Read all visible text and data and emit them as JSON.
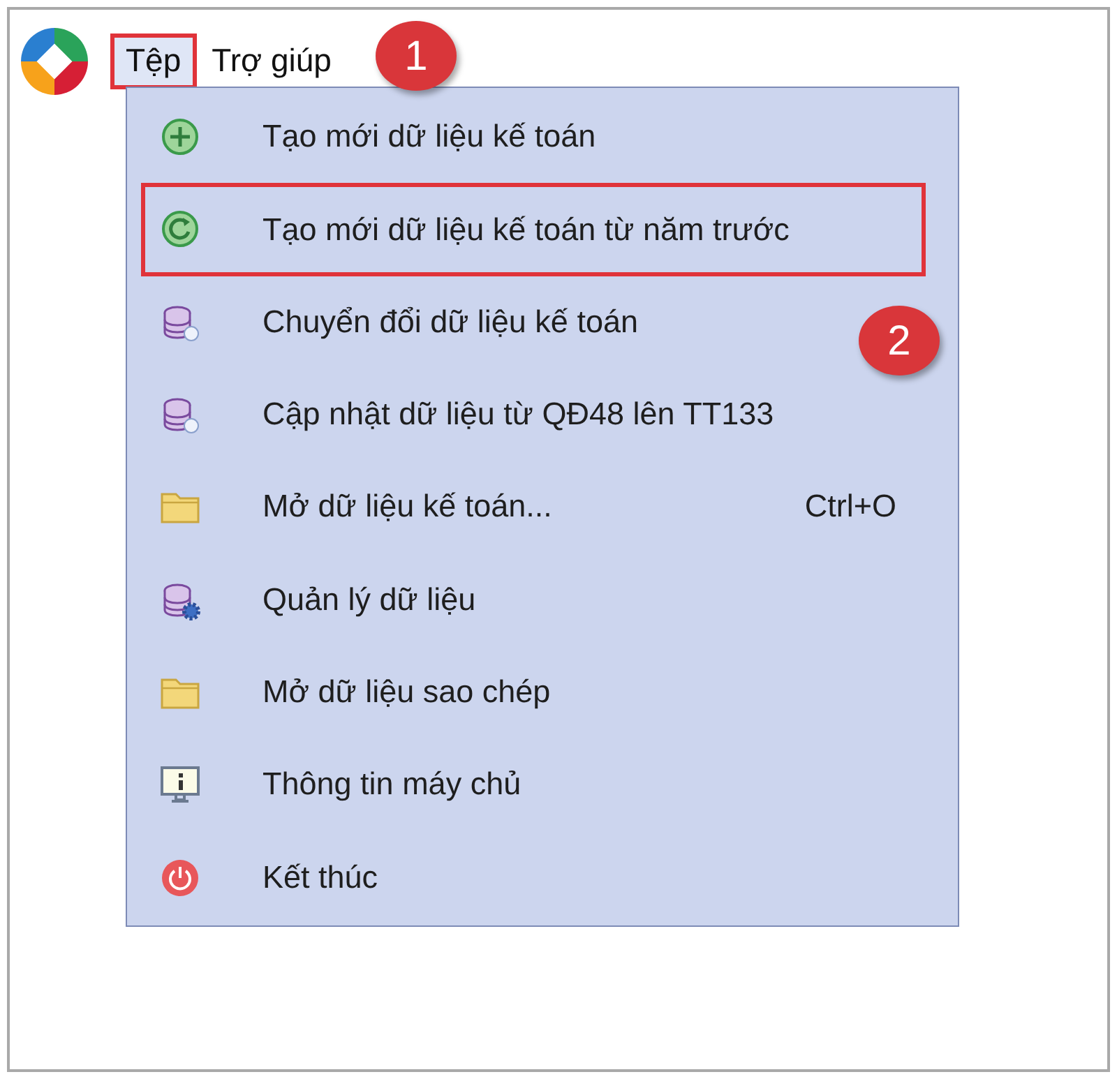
{
  "menubar": [
    {
      "label": "Tệp",
      "selected": true,
      "annotated": true
    },
    {
      "label": "Trợ giúp",
      "selected": false,
      "annotated": false
    }
  ],
  "menu": {
    "items": [
      {
        "label": "Tạo mới dữ liệu kế toán",
        "annotated": false
      },
      {
        "label": "Tạo mới dữ liệu kế toán từ năm trước",
        "annotated": true
      },
      {
        "label": "Chuyển đổi dữ liệu kế toán",
        "annotated": false
      },
      {
        "label": "Cập nhật dữ liệu từ QĐ48 lên TT133",
        "annotated": false
      },
      {
        "label": "Mở dữ liệu kế toán...",
        "shortcut": "Ctrl+O",
        "annotated": false
      },
      {
        "label": "Quản lý dữ liệu",
        "annotated": false
      },
      {
        "label": "Mở dữ liệu sao chép",
        "annotated": false
      },
      {
        "label": "Thông tin máy chủ",
        "annotated": false
      },
      {
        "label": "Kết thúc",
        "annotated": false
      }
    ]
  },
  "step_badges": [
    "1",
    "2"
  ]
}
